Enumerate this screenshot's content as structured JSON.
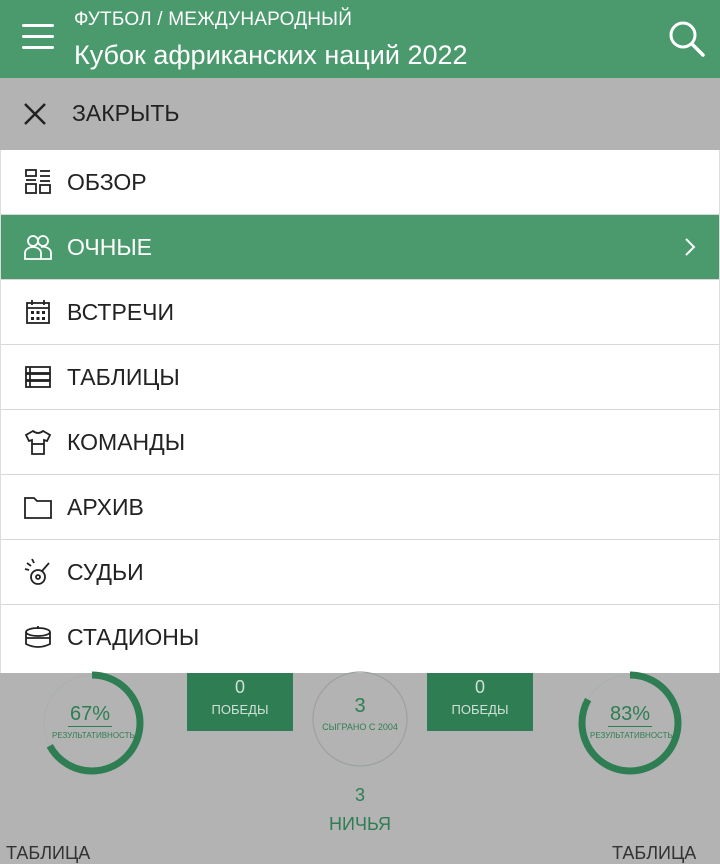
{
  "header": {
    "breadcrumb": "ФУТБОЛ / МЕЖДУНАРОДНЫЙ",
    "title": "Кубок африканских наций 2022"
  },
  "close": {
    "label": "ЗАКРЫТЬ"
  },
  "menu": {
    "items": [
      {
        "label": "ОБЗОР",
        "icon": "overview-icon"
      },
      {
        "label": "ОЧНЫЕ",
        "icon": "head-to-head-icon",
        "active": true
      },
      {
        "label": "ВСТРЕЧИ",
        "icon": "calendar-icon"
      },
      {
        "label": "ТАБЛИЦЫ",
        "icon": "tables-icon"
      },
      {
        "label": "КОМАНДЫ",
        "icon": "jersey-icon"
      },
      {
        "label": "АРХИВ",
        "icon": "folder-icon"
      },
      {
        "label": "СУДЬИ",
        "icon": "whistle-icon"
      },
      {
        "label": "СТАДИОНЫ",
        "icon": "stadium-icon"
      }
    ]
  },
  "stats": {
    "left_ring": {
      "percent": "67%",
      "caption": "РЕЗУЛЬТАТИВНОСТЬ",
      "value": 0.67
    },
    "left_box": {
      "value": "0",
      "caption": "ПОБЕДЫ"
    },
    "center_ring": {
      "value": "3",
      "caption": "СЫГРАНО С 2004"
    },
    "right_box": {
      "value": "0",
      "caption": "ПОБЕДЫ"
    },
    "right_ring": {
      "percent": "83%",
      "caption": "РЕЗУЛЬТАТИВНОСТЬ",
      "value": 0.83
    },
    "draws": {
      "value": "3",
      "caption": "НИЧЬЯ"
    },
    "bottom_left": "ТАБЛИЦА",
    "bottom_right": "ТАБЛИЦА"
  },
  "colors": {
    "primary": "#4a9a6d",
    "dark_green": "#2f7d53",
    "overlay": "#b3b3b3"
  }
}
